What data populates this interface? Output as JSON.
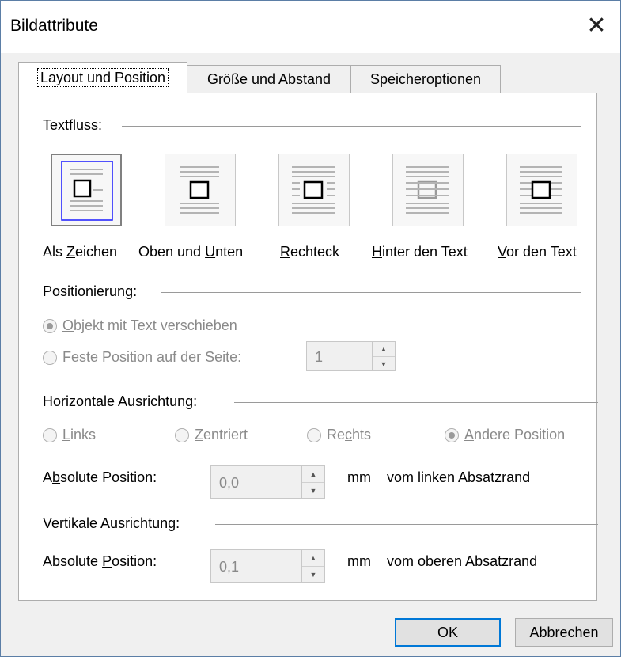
{
  "window": {
    "title": "Bildattribute",
    "close_glyph": "✕"
  },
  "tabs": [
    {
      "label": "Layout und Position"
    },
    {
      "label": "Größe und Abstand"
    },
    {
      "label": "Speicheroptionen"
    }
  ],
  "textfluss": {
    "heading": "Textfluss:",
    "options": [
      {
        "label_pre": "Als ",
        "accel": "Z",
        "label_post": "eichen",
        "icon": "inline-with-text-icon"
      },
      {
        "label_pre": "Oben und ",
        "accel": "U",
        "label_post": "nten",
        "icon": "top-and-bottom-icon"
      },
      {
        "label_pre": "",
        "accel": "R",
        "label_post": "echteck",
        "icon": "square-wrap-icon"
      },
      {
        "label_pre": "",
        "accel": "H",
        "label_post": "inter den Text",
        "icon": "behind-text-icon"
      },
      {
        "label_pre": "",
        "accel": "V",
        "label_post": "or den Text",
        "icon": "in-front-of-text-icon"
      }
    ]
  },
  "positionierung": {
    "heading": "Positionierung:",
    "move_with_text": {
      "accel": "O",
      "rest": "bjekt mit Text verschieben"
    },
    "fixed_position": {
      "accel": "F",
      "rest": "este Position auf der Seite:"
    },
    "page_value": "1"
  },
  "horizontal": {
    "heading": "Horizontale Ausrichtung:",
    "left": {
      "accel": "L",
      "rest": "inks"
    },
    "center": {
      "pre": "",
      "accel": "Z",
      "rest": "entriert"
    },
    "right": {
      "pre": "Re",
      "accel": "c",
      "rest": "hts"
    },
    "other": {
      "accel": "A",
      "rest": "ndere Position"
    },
    "abs_label": {
      "pre": "A",
      "accel": "b",
      "rest": "solute Position:"
    },
    "abs_value": "0,0",
    "unit": "mm",
    "reference": "vom linken Absatzrand"
  },
  "vertical": {
    "heading": "Vertikale Ausrichtung:",
    "abs_label": {
      "pre": "Absolute ",
      "accel": "P",
      "rest": "osition:"
    },
    "abs_value": "0,1",
    "unit": "mm",
    "reference": "vom oberen Absatzrand"
  },
  "buttons": {
    "ok": "OK",
    "cancel": "Abbrechen"
  }
}
